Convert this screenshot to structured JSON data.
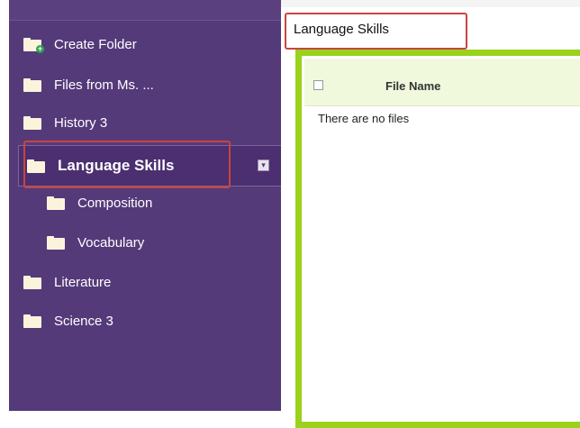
{
  "sidebar": {
    "items": [
      {
        "label": "Create Folder"
      },
      {
        "label": "Files from Ms. ..."
      },
      {
        "label": "History 3"
      },
      {
        "label": "Language Skills"
      },
      {
        "label": "Composition"
      },
      {
        "label": "Vocabulary"
      },
      {
        "label": "Literature"
      },
      {
        "label": "Science 3"
      }
    ],
    "expand_glyph": "▾"
  },
  "main": {
    "breadcrumb": "Language Skills",
    "table": {
      "columns": [
        "File Name"
      ],
      "empty_message": "There are no files"
    }
  },
  "colors": {
    "sidebar_bg": "#553a7a",
    "highlight_border": "#c8453f",
    "panel_border": "#9ad11b",
    "header_bg": "#f1f9dd"
  }
}
